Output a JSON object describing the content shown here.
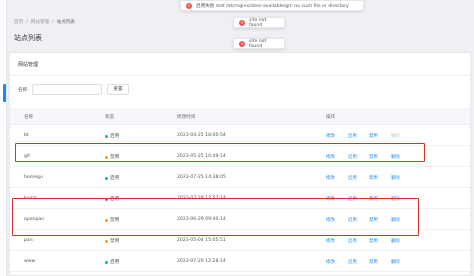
{
  "breadcrumb": [
    "首页",
    "网站管理",
    "站点列表"
  ],
  "page_title": "站点列表",
  "toasts": [
    {
      "message": "启用失败 stat /etc/nginx/sites-available/git: no such file or directory",
      "icon": "x-icon"
    },
    {
      "message": "site not found",
      "icon": "x-icon"
    },
    {
      "message": "site not found",
      "icon": "x-icon"
    }
  ],
  "card_title": "网站管理",
  "filter": {
    "label": "名称",
    "value": "",
    "button": "重置"
  },
  "table": {
    "headers": [
      "名称",
      "状态",
      "修改时间",
      "操作"
    ],
    "rows": [
      {
        "name": "bt",
        "status": "启用",
        "time": "2023-04-25 18:00:54",
        "actions": [
          "修改",
          "启用",
          "禁用",
          "删除"
        ],
        "enabled": true
      },
      {
        "name": "git",
        "status": "禁用",
        "time": "2023-05-25 10:49:14",
        "actions": [
          "修改",
          "启用",
          "禁用",
          "删除"
        ],
        "enabled": false
      },
      {
        "name": "homegu",
        "status": "启用",
        "time": "2023-07-25 14:38:05",
        "actions": [
          "修改",
          "启用",
          "禁用",
          "删除"
        ],
        "enabled": true
      },
      {
        "name": "kuma",
        "status": "启用",
        "time": "2023-07-29 12:57:14",
        "actions": [
          "修改",
          "启用",
          "禁用",
          "删除"
        ],
        "enabled": true
      },
      {
        "name": "openpan",
        "status": "禁用",
        "time": "2023-06-29 09:40:14",
        "actions": [
          "修改",
          "启用",
          "禁用",
          "删除"
        ],
        "enabled": false
      },
      {
        "name": "pan",
        "status": "禁用",
        "time": "2023-05-04 15:05:51",
        "actions": [
          "修改",
          "启用",
          "禁用",
          "删除"
        ],
        "enabled": false
      },
      {
        "name": "www",
        "status": "启用",
        "time": "2023-07-29 12:28:14",
        "actions": [
          "修改",
          "启用",
          "禁用",
          "删除"
        ],
        "enabled": true
      }
    ]
  },
  "colors": {
    "enabled_dot": "#19be6b",
    "disabled_dot": "#f0a020",
    "accent": "#1e88e5",
    "highlight": "#d9302b",
    "error": "#f0504d"
  }
}
